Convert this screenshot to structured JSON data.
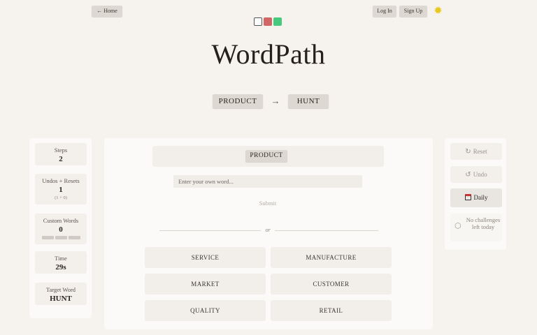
{
  "nav": {
    "home_label": "← Home",
    "login_label": "Log In",
    "signup_label": "Sign Up"
  },
  "title": "WordPath",
  "puzzle": {
    "start": "PRODUCT",
    "arrow": "→",
    "target": "HUNT"
  },
  "stats": {
    "steps_label": "Steps",
    "steps_value": "2",
    "undos_label": "Undos + Resets",
    "undos_value": "1",
    "undos_sub": "(1 + 0)",
    "custom_label": "Custom Words",
    "custom_value": "0",
    "time_label": "Time",
    "time_value": "29s",
    "target_label": "Target Word",
    "target_value": "HUNT"
  },
  "chain": {
    "current": "PRODUCT"
  },
  "input": {
    "placeholder": "Enter your own word...",
    "submit_label": "Submit",
    "or_label": "or"
  },
  "options": [
    "SERVICE",
    "MANUFACTURE",
    "MARKET",
    "CUSTOMER",
    "QUALITY",
    "RETAIL"
  ],
  "actions": {
    "reset_label": "Reset",
    "undo_label": "Undo",
    "daily_label": "Daily",
    "challenge_info": "No challenges left today"
  },
  "colors": {
    "background": "#f6f3ef",
    "theme_swatches": [
      "#ffffff",
      "#d26565",
      "#46c97c"
    ],
    "sun_icon": "#e8c81c"
  }
}
